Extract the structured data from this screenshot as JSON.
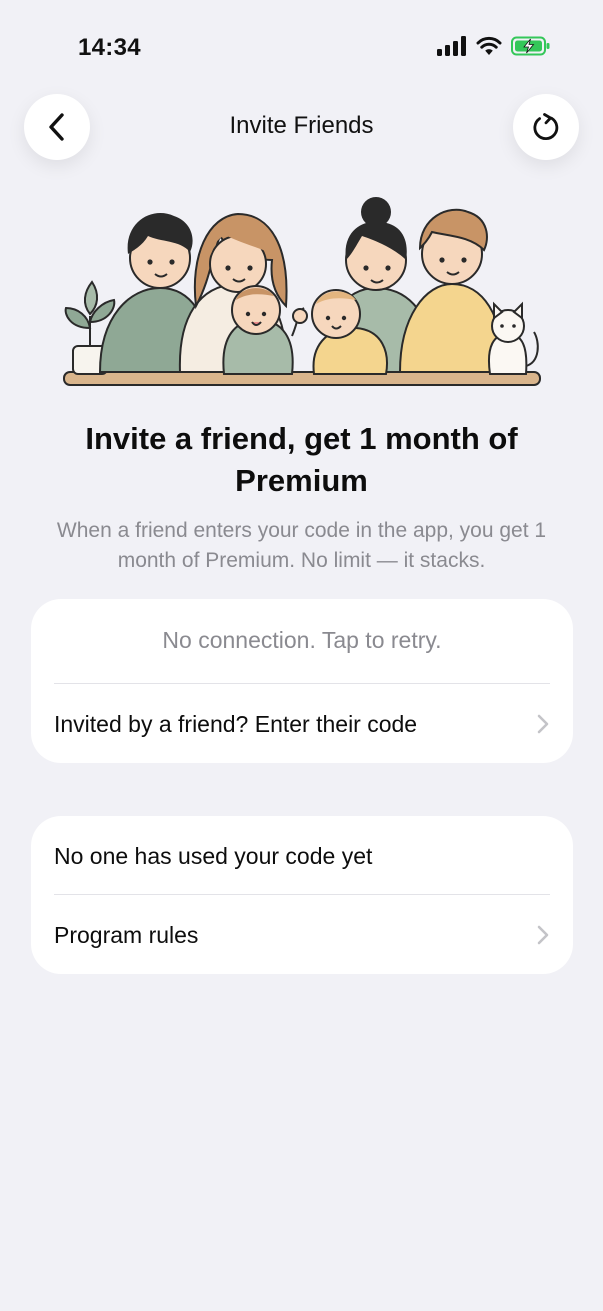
{
  "status_bar": {
    "time": "14:34",
    "icons": [
      "cellular-signal-icon",
      "wifi-icon",
      "battery-charging-icon"
    ],
    "battery_color": "#34C759"
  },
  "nav": {
    "title": "Invite Friends",
    "back_icon": "chevron-left-icon",
    "refresh_icon": "refresh-icon"
  },
  "illustration": {
    "name": "family-illustration"
  },
  "hero": {
    "headline": "Invite a friend, get 1 month of Premium",
    "subtext": "When a friend enters your code in the app, you get 1 month of Premium. No limit — it stacks."
  },
  "code_card": {
    "retry_text": "No connection. Tap to retry.",
    "enter_code_label": "Invited by a friend? Enter their code"
  },
  "usage_card": {
    "usage_text": "No one has used your code yet",
    "rules_label": "Program rules"
  },
  "colors": {
    "background": "#F1F1F6",
    "card": "#FFFFFF",
    "secondary_text": "#8A8A90",
    "chevron": "#C4C4C8"
  }
}
